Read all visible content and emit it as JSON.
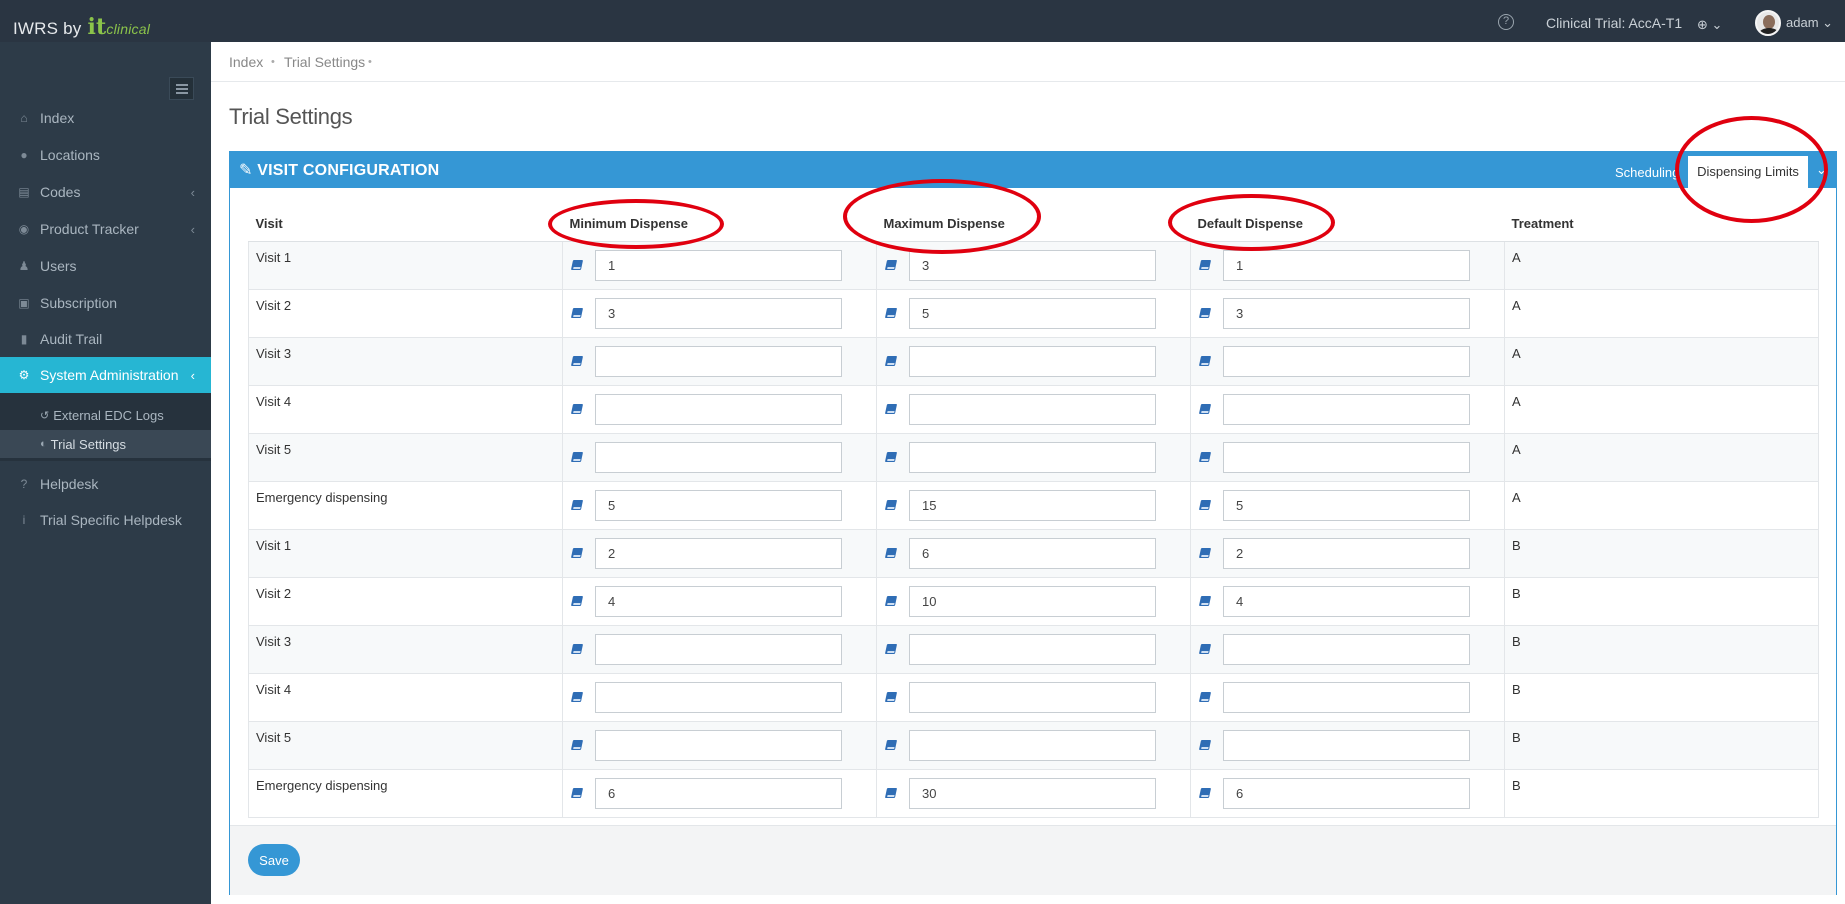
{
  "app": {
    "brand_prefix": "IWRS by",
    "brand_it": "it",
    "brand_clinical": "clinical",
    "clinical_trial": "Clinical Trial: AccA-T1",
    "help_icon": "question-circle-icon",
    "globe_icon": "globe-icon",
    "user": "adam"
  },
  "sidebar": {
    "items": [
      {
        "label": "Index",
        "icon": "home-icon"
      },
      {
        "label": "Locations",
        "icon": "globe-icon"
      },
      {
        "label": "Codes",
        "icon": "barcode-icon",
        "chevron": "‹"
      },
      {
        "label": "Product Tracker",
        "icon": "map-marker-icon",
        "chevron": "‹"
      },
      {
        "label": "Users",
        "icon": "users-icon"
      },
      {
        "label": "Subscription",
        "icon": "archive-icon"
      },
      {
        "label": "Audit Trail",
        "icon": "book-icon"
      },
      {
        "label": "System Administration",
        "icon": "cogs-icon",
        "chevron": "‹"
      },
      {
        "label": "Helpdesk",
        "icon": "question-icon"
      },
      {
        "label": "Trial Specific Helpdesk",
        "icon": "info-icon"
      }
    ],
    "subitems": [
      {
        "label": "External EDC Logs",
        "icon": "history-icon"
      },
      {
        "label": "Trial Settings",
        "icon": "toggle-icon"
      }
    ]
  },
  "breadcrumb": [
    "Index",
    "Trial Settings"
  ],
  "page_title": "Trial Settings",
  "panel": {
    "title": "VISIT CONFIGURATION",
    "tabs": [
      "Scheduling",
      "Dispensing Limits"
    ],
    "active_tab": "Dispensing Limits"
  },
  "table": {
    "headers": [
      "Visit",
      "Minimum Dispense",
      "Maximum Dispense",
      "Default Dispense",
      "Treatment"
    ],
    "rows": [
      {
        "visit": "Visit 1",
        "min": "1",
        "max": "3",
        "def": "1",
        "treatment": "A"
      },
      {
        "visit": "Visit 2",
        "min": "3",
        "max": "5",
        "def": "3",
        "treatment": "A"
      },
      {
        "visit": "Visit 3",
        "min": "",
        "max": "",
        "def": "",
        "treatment": "A"
      },
      {
        "visit": "Visit 4",
        "min": "",
        "max": "",
        "def": "",
        "treatment": "A"
      },
      {
        "visit": "Visit 5",
        "min": "",
        "max": "",
        "def": "",
        "treatment": "A"
      },
      {
        "visit": "Emergency dispensing",
        "min": "5",
        "max": "15",
        "def": "5",
        "treatment": "A"
      },
      {
        "visit": "Visit 1",
        "min": "2",
        "max": "6",
        "def": "2",
        "treatment": "B"
      },
      {
        "visit": "Visit 2",
        "min": "4",
        "max": "10",
        "def": "4",
        "treatment": "B"
      },
      {
        "visit": "Visit 3",
        "min": "",
        "max": "",
        "def": "",
        "treatment": "B"
      },
      {
        "visit": "Visit 4",
        "min": "",
        "max": "",
        "def": "",
        "treatment": "B"
      },
      {
        "visit": "Visit 5",
        "min": "",
        "max": "",
        "def": "",
        "treatment": "B"
      },
      {
        "visit": "Emergency dispensing",
        "min": "6",
        "max": "30",
        "def": "6",
        "treatment": "B"
      }
    ]
  },
  "save_label": "Save",
  "annotation_color": "#e0000f",
  "accent_color": "#3597d5",
  "active_nav_color": "#26b6d3"
}
